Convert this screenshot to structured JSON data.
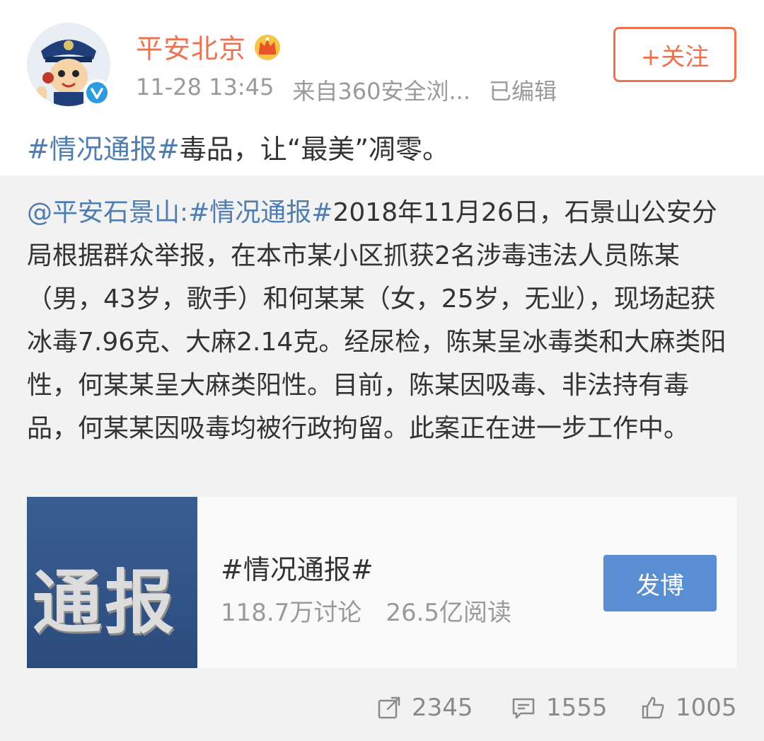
{
  "user": {
    "name": "平安北京",
    "timestamp": "11-28 13:45",
    "source": "来自360安全浏...",
    "edited": "已编辑"
  },
  "follow": {
    "label": "+关注"
  },
  "post": {
    "topic": "#情况通报#",
    "text": "毒品，让“最美”凋零。"
  },
  "repost": {
    "mention": "@平安石景山:",
    "topic": "#情况通报#",
    "text": "2018年11月26日，石景山公安分局根据群众举报，在本市某小区抓获2名涉毒违法人员陈某（男，43岁，歌手）和何某某（女，25岁，无业），现场起获冰毒7.96克、大麻2.14克。经尿检，陈某呈冰毒类和大麻类阳性，何某某呈大麻类阳性。目前，陈某因吸毒、非法持有毒品，何某某因吸毒均被行政拘留。此案正在进一步工作中。"
  },
  "topic_card": {
    "thumb_text": "通报",
    "title": "#情况通报#",
    "discussions": "118.7万讨论",
    "reads": "26.5亿阅读",
    "button_label": "发博"
  },
  "actions": {
    "repost_count": "2345",
    "comment_count": "1555",
    "like_count": "1005"
  },
  "colors": {
    "accent": "#eb7350",
    "link": "#507daf",
    "button_blue": "#5a8ed3"
  }
}
